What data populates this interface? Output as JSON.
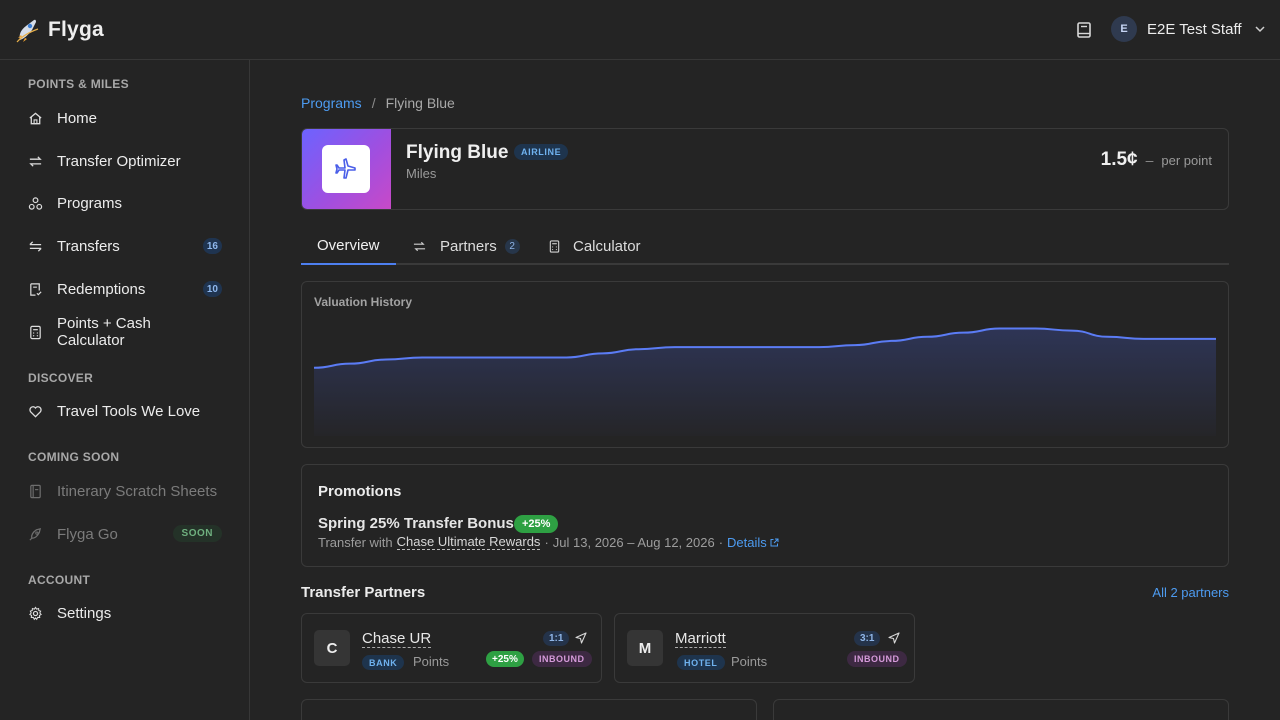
{
  "app": {
    "name": "Flyga"
  },
  "user": {
    "initial": "E",
    "name": "E2E Test Staff"
  },
  "sidebar": {
    "sections": [
      {
        "title": "POINTS & MILES"
      },
      {
        "title": "DISCOVER"
      },
      {
        "title": "COMING SOON"
      },
      {
        "title": "ACCOUNT"
      }
    ],
    "items": [
      {
        "label": "Home",
        "icon": "home-icon"
      },
      {
        "label": "Transfer Optimizer",
        "icon": "arrows-exchange-icon"
      },
      {
        "label": "Programs",
        "icon": "programs-icon"
      },
      {
        "label": "Transfers",
        "icon": "transfers-icon",
        "badge": "16"
      },
      {
        "label": "Redemptions",
        "icon": "receipt-icon",
        "badge": "10"
      },
      {
        "label": "Points + Cash Calculator",
        "icon": "calculator-icon"
      },
      {
        "label": "Travel Tools We Love",
        "icon": "heart-icon"
      },
      {
        "label": "Itinerary Scratch Sheets",
        "icon": "notebook-icon"
      },
      {
        "label": "Flyga Go",
        "icon": "rocket-icon",
        "badge": "SOON"
      },
      {
        "label": "Settings",
        "icon": "gear-icon"
      }
    ]
  },
  "breadcrumb": {
    "parent": "Programs",
    "separator": "/",
    "current": "Flying Blue"
  },
  "program": {
    "name": "Flying Blue",
    "type": "AIRLINE",
    "unit": "Miles",
    "value": "1.5¢",
    "dash": "–",
    "per": "per point"
  },
  "tabs": [
    {
      "label": "Overview"
    },
    {
      "label": "Partners",
      "count": "2"
    },
    {
      "label": "Calculator"
    }
  ],
  "chart_data": {
    "type": "area",
    "title": "Valuation History",
    "x": [
      0,
      1,
      2,
      3,
      4,
      5,
      6,
      7,
      8,
      9,
      10,
      11,
      12,
      13,
      14,
      15,
      16,
      17,
      18,
      19,
      20,
      21,
      22,
      23,
      24,
      25
    ],
    "values": [
      1.33,
      1.35,
      1.37,
      1.38,
      1.38,
      1.38,
      1.38,
      1.38,
      1.4,
      1.42,
      1.43,
      1.43,
      1.43,
      1.43,
      1.43,
      1.44,
      1.46,
      1.48,
      1.5,
      1.52,
      1.52,
      1.51,
      1.48,
      1.47,
      1.47,
      1.47
    ],
    "ylim": [
      1.0,
      1.6
    ],
    "grid": false,
    "colors": {
      "line": "#5b7cf5",
      "fill_top": "#2e3556",
      "fill_bottom": "#252528"
    }
  },
  "promotions": {
    "title": "Promotions",
    "items": [
      {
        "name": "Spring 25% Transfer Bonus",
        "bonus": "+25%",
        "prefix": "Transfer with",
        "partner": "Chase Ultimate Rewards",
        "sep1": "·",
        "dates": "Jul 13, 2026 – Aug 12, 2026",
        "sep2": "·",
        "details": "Details"
      }
    ]
  },
  "transfer_partners": {
    "title": "Transfer Partners",
    "all_link": "All 2 partners",
    "items": [
      {
        "letter": "C",
        "name": "Chase UR",
        "type": "BANK",
        "unit": "Points",
        "ratio": "1:1",
        "bonus": "+25%",
        "direction": "INBOUND"
      },
      {
        "letter": "M",
        "name": "Marriott",
        "type": "HOTEL",
        "unit": "Points",
        "ratio": "3:1",
        "direction": "INBOUND"
      }
    ]
  }
}
